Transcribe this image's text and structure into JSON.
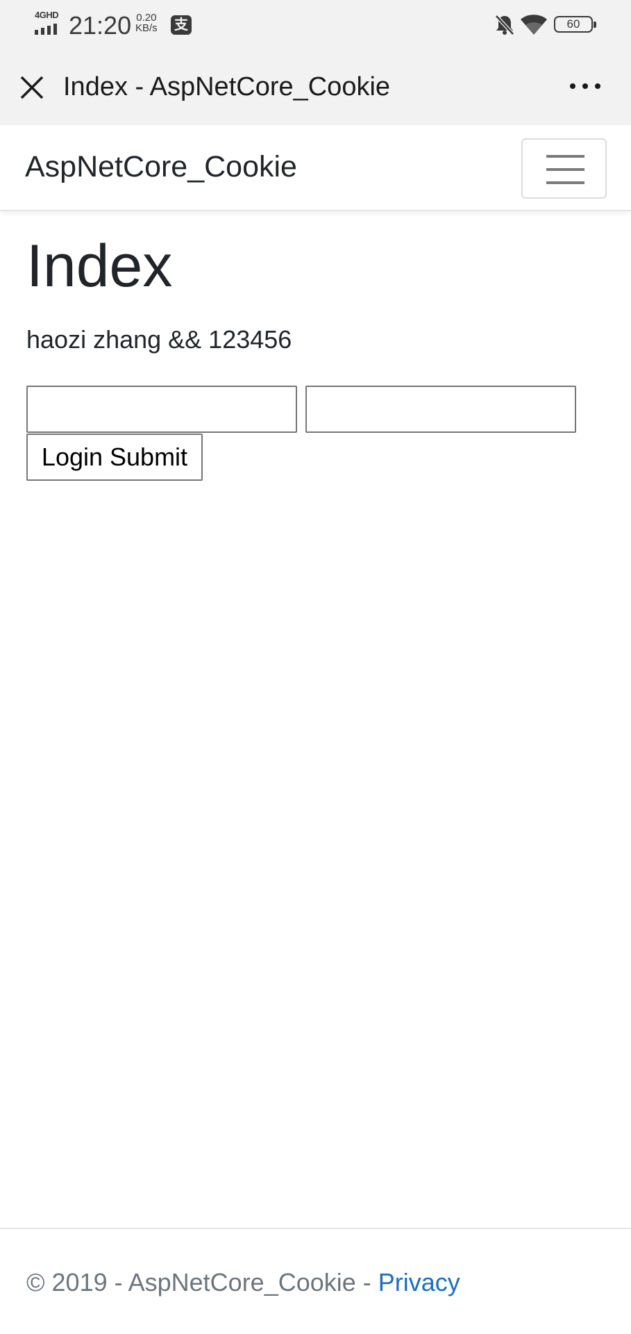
{
  "status_bar": {
    "network": "4GHD",
    "time": "21:20",
    "speed_value": "0.20",
    "speed_unit": "KB/s",
    "pay_glyph": "支",
    "battery": "60",
    "icons": [
      "signal-icon",
      "mute-bell-icon",
      "wifi-icon",
      "battery-icon"
    ]
  },
  "title_bar": {
    "title": "Index - AspNetCore_Cookie",
    "close_icon": "close-icon",
    "more_icon": "more-dots-icon"
  },
  "navbar": {
    "brand": "AspNetCore_Cookie",
    "toggler_icon": "hamburger-icon"
  },
  "main": {
    "heading": "Index",
    "credentials_text": "haozi zhang && 123456",
    "username_value": "",
    "password_value": "",
    "submit_label": "Login Submit"
  },
  "footer": {
    "copyright": "© 2019 - AspNetCore_Cookie - ",
    "privacy_link": "Privacy",
    "link_color": "#1b6ec2"
  }
}
